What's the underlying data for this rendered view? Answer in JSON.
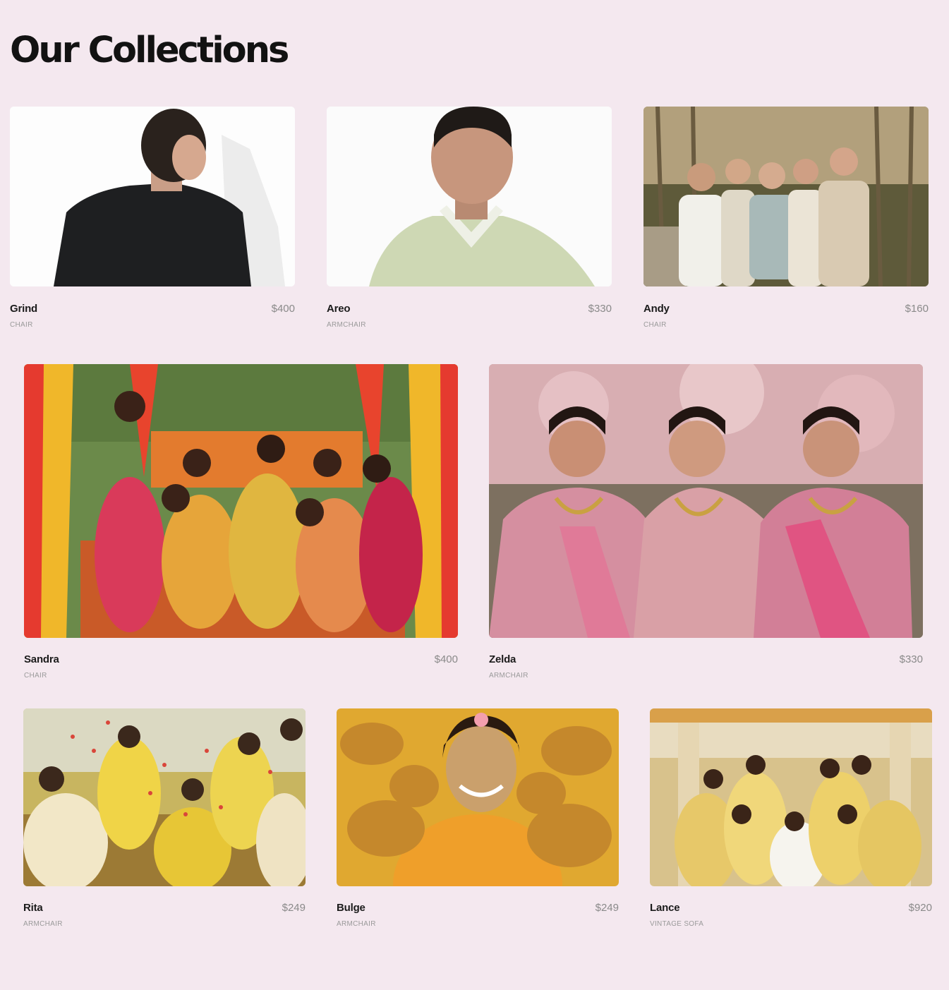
{
  "page": {
    "title": "Our Collections"
  },
  "products": [
    {
      "name": "Grind",
      "price": "$400",
      "category": "CHAIR",
      "image": "man-black-shirt-back-view-photo"
    },
    {
      "name": "Areo",
      "price": "$330",
      "category": "ARMCHAIR",
      "image": "man-green-polo-portrait-photo"
    },
    {
      "name": "Andy",
      "price": "$160",
      "category": "CHAIR",
      "image": "family-group-forest-photo"
    },
    {
      "name": "Sandra",
      "price": "$400",
      "category": "CHAIR",
      "image": "women-haldi-ceremony-colorful-canopy-photo"
    },
    {
      "name": "Zelda",
      "price": "$330",
      "category": "ARMCHAIR",
      "image": "three-women-pink-saree-photo"
    },
    {
      "name": "Rita",
      "price": "$249",
      "category": "ARMCHAIR",
      "image": "yellow-dress-petal-shower-photo"
    },
    {
      "name": "Bulge",
      "price": "$249",
      "category": "ARMCHAIR",
      "image": "bride-haldi-hands-photo"
    },
    {
      "name": "Lance",
      "price": "$920",
      "category": "VINTAGE SOFA",
      "image": "haldi-group-celebration-photo"
    }
  ]
}
